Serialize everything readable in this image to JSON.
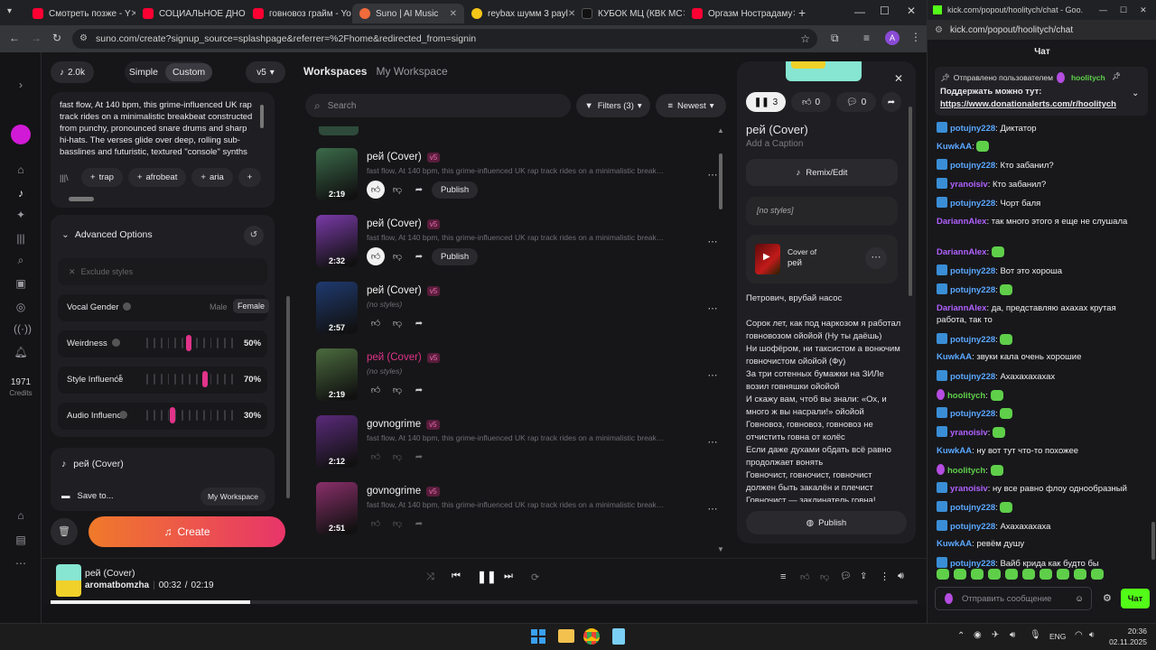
{
  "tabs": [
    {
      "label": "Смотреть позже - Y",
      "color": "#ff0033"
    },
    {
      "label": "СОЦИАЛЬНОЕ ДНО",
      "color": "#ff0033"
    },
    {
      "label": "говновоз грайм - Yo",
      "color": "#ff0033"
    },
    {
      "label": "Suno | AI Music",
      "color": "#f26b3a"
    },
    {
      "label": "reybax шумм 3 рауl",
      "color": "#f5c518"
    },
    {
      "label": "КУБОК МЦ (КВК МС",
      "color": "#222222"
    },
    {
      "label": "Оргазм Нострадаму",
      "color": "#ff0033"
    }
  ],
  "address": "suno.com/create?signup_source=splashpage&referrer=%2Fhome&redirected_from=signin",
  "profile_initial": "A",
  "rail": {
    "credits_value": "1971",
    "credits_label": "Credits"
  },
  "left": {
    "count": "2.0k",
    "mode_simple": "Simple",
    "mode_custom": "Custom",
    "model": "v5",
    "style_text": "fast flow, At 140 bpm, this grime-influenced UK rap track rides on a minimalistic breakbeat constructed from punchy, pronounced snare drums and sharp hi-hats. The verses glide over deep, rolling sub-basslines and futuristic, textured \"console\" synths that bring a",
    "tags": [
      "trap",
      "afrobeat",
      "aria"
    ],
    "advanced_label": "Advanced Options",
    "exclude_placeholder": "Exclude styles",
    "vocal_gender_label": "Vocal Gender",
    "male": "Male",
    "female": "Female",
    "weirdness_label": "Weirdness",
    "weirdness_value": "50%",
    "style_influence_label": "Style Influence",
    "style_influence_value": "70%",
    "audio_influence_label": "Audio Influence",
    "audio_influence_value": "30%",
    "song_title": "рей (Cover)",
    "save_to_label": "Save to...",
    "workspace_button": "My Workspace",
    "create_label": "Create"
  },
  "mid": {
    "breadcrumb_root": "Workspaces",
    "breadcrumb_current": "My Workspace",
    "search_placeholder": "Search",
    "filters_label": "Filters (3)",
    "sort_label": "Newest",
    "songs": [
      {
        "title": "рей (Cover)",
        "version": "v5",
        "desc": "fast flow, At 140 bpm, this grime-influenced UK rap track rides on a minimalistic breakbeat const...",
        "duration": "2:19",
        "publish": "Publish",
        "bg": "#3b6b4a"
      },
      {
        "title": "рей (Cover)",
        "version": "v5",
        "desc": "fast flow, At 140 bpm, this grime-influenced UK rap track rides on a minimalistic breakbeat const...",
        "duration": "2:32",
        "publish": "Publish",
        "bg": "#7a3aa8"
      },
      {
        "title": "рей (Cover)",
        "version": "v5",
        "desc": "(no styles)",
        "duration": "2:57",
        "publish": "",
        "bg": "#1f3a70"
      },
      {
        "title": "рей (Cover)",
        "version": "v5",
        "desc": "(no styles)",
        "duration": "2:19",
        "publish": "",
        "bg": "#4b6b3e"
      },
      {
        "title": "govnogrime",
        "version": "v5",
        "desc": "fast flow, At 140 bpm, this grime-influenced UK rap track rides on a minimalistic breakbeat const...",
        "duration": "2:12",
        "publish": "",
        "bg": "#5a2a7a"
      },
      {
        "title": "govnogrime",
        "version": "v5",
        "desc": "fast flow, At 140 bpm, this grime-influenced UK rap track rides on a minimalistic breakbeat const...",
        "duration": "2:51",
        "publish": "",
        "bg": "#8a2f6a"
      }
    ]
  },
  "right": {
    "play_count": "3",
    "likes": "0",
    "comments": "0",
    "title": "рей (Cover)",
    "caption_placeholder": "Add a Caption",
    "remix_label": "Remix/Edit",
    "styles": "[no styles]",
    "cover_of_label": "Cover of",
    "cover_of_title": "рей",
    "lyrics": "Петрович, врубай насос\n\nСорок лет, как под наркозом я работал говновозом ойойой (Ну ты даёшь)\nНи шофёром, ни таксистом а вонючим говночистом ойойой (Фу)\nЗа три сотенных бумажки на ЗИЛе возил говняшки ойойой\nИ скажу вам, чтоб вы знали: «Ох, и много ж вы насрали!» ойойой\nГовновоз, говновоз, говновоз не отчистить говна от колёс\nЕсли даже духами обдать всё равно продолжает вонять\nГовночист, говночист, говночист должен быть закалён и плечист\nГовночист — заклинатель говна!Нужен",
    "publish_label": "Publish"
  },
  "player": {
    "title": "рей (Cover)",
    "artist": "aromatbomzha",
    "elapsed": "00:32",
    "sep": "/",
    "total": "02:19",
    "progress": 0.23
  },
  "chat": {
    "url": "kick.com/popout/hoolitych/chat - Goo...",
    "address": "kick.com/popout/hoolitych/chat",
    "heading": "Чат",
    "pinned_by": "Отправлено пользователем",
    "pinned_user": "hoolitych",
    "pinned_text": "Поддержать можно тут:",
    "pinned_link": "https://www.donationalerts.com/r/hoolitych",
    "messages": [
      {
        "user": "potujny228",
        "color": "#5aa8ff",
        "badge": "kick",
        "text": "Диктатор"
      },
      {
        "user": "KuwkAA",
        "color": "#5aa8ff",
        "badge": "",
        "text": ""
      },
      {
        "user": "potujny228",
        "color": "#5aa8ff",
        "badge": "kick",
        "text": "Кто забанил?"
      },
      {
        "user": "yranoisiv",
        "color": "#b061ff",
        "badge": "kick",
        "text": "Кто забанил?"
      },
      {
        "user": "potujny228",
        "color": "#5aa8ff",
        "badge": "kick",
        "text": "Чорт баля"
      },
      {
        "user": "DariannAlex",
        "color": "#b061ff",
        "badge": "",
        "text": "так много этого я еще не слушала"
      },
      {
        "user": "DariannAlex",
        "color": "#b061ff",
        "badge": "",
        "text": ""
      },
      {
        "user": "potujny228",
        "color": "#5aa8ff",
        "badge": "kick",
        "text": "Вот это хороша"
      },
      {
        "user": "potujny228",
        "color": "#5aa8ff",
        "badge": "kick",
        "text": ""
      },
      {
        "user": "DariannAlex",
        "color": "#b061ff",
        "badge": "",
        "text": "да, представляю ахахах крутая работа, так то"
      },
      {
        "user": "potujny228",
        "color": "#5aa8ff",
        "badge": "kick",
        "text": ""
      },
      {
        "user": "KuwkAA",
        "color": "#5aa8ff",
        "badge": "",
        "text": "звуки кала очень хорошие"
      },
      {
        "user": "potujny228",
        "color": "#5aa8ff",
        "badge": "kick",
        "text": "Ахахахахахах"
      },
      {
        "user": "hoolitych",
        "color": "#5fcf4a",
        "badge": "mic",
        "text": ""
      },
      {
        "user": "potujny228",
        "color": "#5aa8ff",
        "badge": "kick",
        "text": ""
      },
      {
        "user": "yranoisiv",
        "color": "#b061ff",
        "badge": "kick",
        "text": ""
      },
      {
        "user": "KuwkAA",
        "color": "#5aa8ff",
        "badge": "",
        "text": "ну вот тут что-то похожее"
      },
      {
        "user": "hoolitych",
        "color": "#5fcf4a",
        "badge": "mic",
        "text": ""
      },
      {
        "user": "yranoisiv",
        "color": "#b061ff",
        "badge": "kick",
        "text": "ну все равно флоу однообразный"
      },
      {
        "user": "potujny228",
        "color": "#5aa8ff",
        "badge": "kick",
        "text": ""
      },
      {
        "user": "potujny228",
        "color": "#5aa8ff",
        "badge": "kick",
        "text": "Ахахахахаха"
      },
      {
        "user": "KuwkAA",
        "color": "#5aa8ff",
        "badge": "",
        "text": "ревём душу"
      },
      {
        "user": "potujny228",
        "color": "#5aa8ff",
        "badge": "kick",
        "text": "Вайб крида как будто бы"
      }
    ],
    "input_placeholder": "Отправить сообщение",
    "send_label": "Чат"
  },
  "taskbar": {
    "lang": "ENG",
    "time": "20:36",
    "date": "02.11.2025"
  },
  "accent": "#e0338a"
}
